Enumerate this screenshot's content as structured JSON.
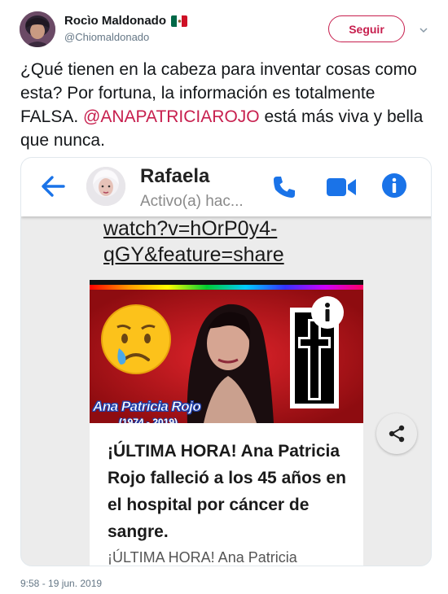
{
  "tweet": {
    "author_name": "Rocìo Maldonado",
    "author_handle": "@Chiomaldonado",
    "follow_label": "Seguir",
    "text_before": "¿Qué tienen en la cabeza para inventar cosas como esta? Por fortuna, la información es totalmente FALSA. ",
    "mention": "@ANAPATRICIAROJO",
    "text_after": " está más viva y bella que nunca.",
    "timestamp": "9:58 - 19 jun. 2019"
  },
  "screenshot": {
    "contact_name": "Rafaela",
    "contact_status": "Activo(a) hac...",
    "link_line_1": "watch?v=hOrP0y4-",
    "link_line_2": "qGY&feature=share",
    "image_caption": "Ana Patricia Rojo",
    "image_subcaption": "(1974 - 2019)",
    "headline": "¡ÚLTIMA HORA! Ana Patricia Rojo falleció a los 45 años en el hospital por cáncer de sangre.",
    "subheadline": "¡ÚLTIMA HORA! Ana Patricia"
  },
  "colors": {
    "accent": "#c71f4e",
    "messenger_blue": "#1a73e8",
    "image_red": "#b8141a"
  },
  "icons": {
    "flag": "mexico-flag-icon",
    "caret": "chevron-down-icon",
    "back": "arrow-left-icon",
    "phone": "phone-icon",
    "video": "video-camera-icon",
    "info": "info-icon",
    "share": "share-icon",
    "emoji": "crying-face-emoji",
    "cross": "cross-icon"
  }
}
